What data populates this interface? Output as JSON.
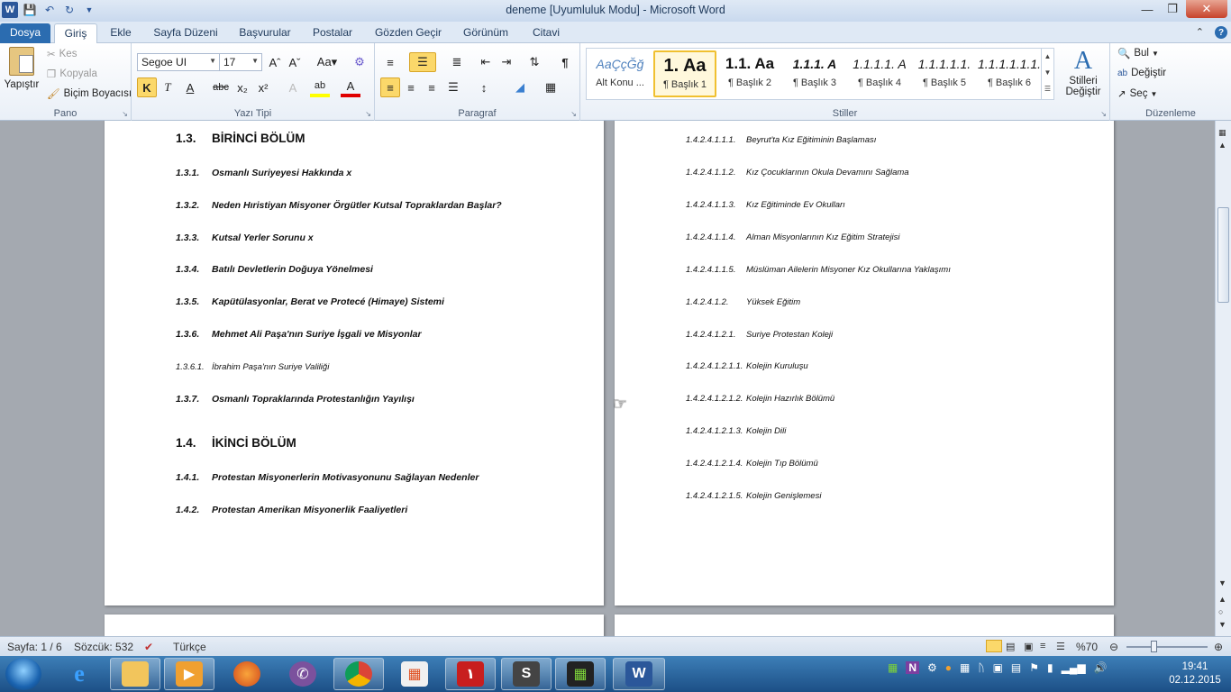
{
  "window": {
    "title": "deneme [Uyumluluk Modu]  -  Microsoft Word"
  },
  "tabs": [
    "Dosya",
    "Giriş",
    "Ekle",
    "Sayfa Düzeni",
    "Başvurular",
    "Postalar",
    "Gözden Geçir",
    "Görünüm",
    "Citavi"
  ],
  "ribbon": {
    "clipboard": {
      "paste": "Yapıştır",
      "cut": "Kes",
      "copy": "Kopyala",
      "format_painter": "Biçim Boyacısı",
      "label": "Pano"
    },
    "font": {
      "name": "Segoe UI",
      "size": "17",
      "label": "Yazı Tipi"
    },
    "paragraph": {
      "label": "Paragraf"
    },
    "styles": {
      "label": "Stiller",
      "items": [
        {
          "sample": "AaÇçĞğ",
          "name": "Alt Konu ..."
        },
        {
          "sample": "1.  Aa",
          "name": "¶ Başlık 1"
        },
        {
          "sample": "1.1.  Aa",
          "name": "¶ Başlık 2"
        },
        {
          "sample": "1.1.1.  A",
          "name": "¶ Başlık 3"
        },
        {
          "sample": "1.1.1.1.  A",
          "name": "¶ Başlık 4"
        },
        {
          "sample": "1.1.1.1.1.",
          "name": "¶ Başlık 5"
        },
        {
          "sample": "1.1.1.1.1.1.",
          "name": "¶ Başlık 6"
        }
      ],
      "change_styles": "Stilleri Değiştir"
    },
    "editing": {
      "find": "Bul",
      "replace": "Değiştir",
      "select": "Seç",
      "label": "Düzenleme"
    }
  },
  "left_page": [
    {
      "num": "1.3.",
      "text": "BİRİNCİ BÖLÜM",
      "level": "h1"
    },
    {
      "num": "1.3.1.",
      "text": "Osmanlı Suriyeyesi  Hakkında x",
      "level": "h2"
    },
    {
      "num": "1.3.2.",
      "text": "Neden Hıristiyan Misyoner Örgütler Kutsal Topraklardan Başlar?",
      "level": "h2"
    },
    {
      "num": "1.3.3.",
      "text": "Kutsal Yerler Sorunu x",
      "level": "h2"
    },
    {
      "num": "1.3.4.",
      "text": "Batılı Devletlerin Doğuya Yönelmesi",
      "level": "h2"
    },
    {
      "num": "1.3.5.",
      "text": "Kapütülasyonlar, Berat ve Protecé (Himaye) Sistemi",
      "level": "h2"
    },
    {
      "num": "1.3.6.",
      "text": "Mehmet Ali Paşa'nın Suriye İşgali ve Misyonlar",
      "level": "h2"
    },
    {
      "num": "1.3.6.1.",
      "text": "İbrahim Paşa'nın Suriye Valiliği",
      "level": "h3"
    },
    {
      "num": "1.3.7.",
      "text": "Osmanlı Topraklarında Protestanlığın Yayılışı",
      "level": "h2"
    },
    {
      "num": "1.4.",
      "text": "İKİNCİ BÖLÜM",
      "level": "h1"
    },
    {
      "num": "1.4.1.",
      "text": "Protestan Misyonerlerin Motivasyonunu Sağlayan Nedenler",
      "level": "h2"
    },
    {
      "num": "1.4.2.",
      "text": "Protestan Amerikan Misyonerlik Faaliyetleri",
      "level": "h2"
    }
  ],
  "right_page": [
    {
      "num": "1.4.2.4.1.1.1.",
      "text": "Beyrut'ta Kız Eğitiminin Başlaması"
    },
    {
      "num": "1.4.2.4.1.1.2.",
      "text": "Kız Çocuklarının Okula Devamını Sağlama"
    },
    {
      "num": "1.4.2.4.1.1.3.",
      "text": "Kız Eğitiminde Ev Okulları"
    },
    {
      "num": "1.4.2.4.1.1.4.",
      "text": "Alman Misyonlarının Kız Eğitim Stratejisi"
    },
    {
      "num": "1.4.2.4.1.1.5.",
      "text": "Müslüman Ailelerin Misyoner Kız Okullarına Yaklaşımı"
    },
    {
      "num": "1.4.2.4.1.2.",
      "text": "Yüksek Eğitim"
    },
    {
      "num": "1.4.2.4.1.2.1.",
      "text": "Suriye Protestan Koleji"
    },
    {
      "num": "1.4.2.4.1.2.1.1.",
      "text": "Kolejin Kuruluşu"
    },
    {
      "num": "1.4.2.4.1.2.1.2.",
      "text": "Kolejin Hazırlık Bölümü"
    },
    {
      "num": "1.4.2.4.1.2.1.3.",
      "text": "Kolejin Dili"
    },
    {
      "num": "1.4.2.4.1.2.1.4.",
      "text": "Kolejin Tıp Bölümü"
    },
    {
      "num": "1.4.2.4.1.2.1.5.",
      "text": "Kolejin Genişlemesi"
    }
  ],
  "status": {
    "page": "Sayfa: 1 / 6",
    "words": "Sözcük: 532",
    "language": "Türkçe",
    "zoom": "%70"
  },
  "clock": {
    "time": "19:41",
    "date": "02.12.2015"
  },
  "colors": {
    "accent": "#2b579a",
    "file_tab": "#2b6cb0",
    "taskbar": "#1c4f86"
  }
}
